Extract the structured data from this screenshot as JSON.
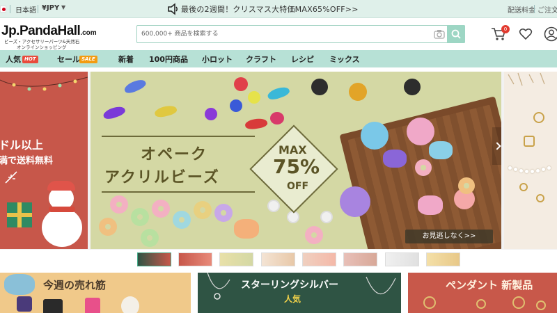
{
  "topbar": {
    "language": "日本語",
    "currency": "¥JPY",
    "announcement": "最後の2週間！クリスマス大特価MAX65%OFF>>",
    "shipping_fee": "配送料金",
    "order_guide": "ご注文"
  },
  "header": {
    "logo_main": "Jp.PandaHall",
    "logo_com": ".com",
    "logo_sub1": "ビーズ・アクセサリーパーツ&天然石",
    "logo_sub2": "オンラインショッピング",
    "search_placeholder": "600,000+ 商品を検索する",
    "cart_count": "0"
  },
  "nav": {
    "items": [
      {
        "label": "人気",
        "badge": "HOT"
      },
      {
        "label": "セール",
        "badge": "SALE"
      },
      {
        "label": "新着"
      },
      {
        "label": "100円商品"
      },
      {
        "label": "小ロット"
      },
      {
        "label": "クラフト"
      },
      {
        "label": "レシピ"
      },
      {
        "label": "ミックス"
      }
    ]
  },
  "hero": {
    "left_line1": "ドル以上",
    "left_line2": "満で送料無料",
    "title_line1": "オペーク",
    "title_line2": "アクリルビーズ",
    "badge_max": "MAX",
    "badge_percent": "75%",
    "badge_off": "OFF",
    "see_more": "お見逃しなく>>"
  },
  "cards": {
    "weekly_bestsellers": "今週の売れ筋",
    "sterling_silver": "スターリングシルバー",
    "sterling_silver_badge": "人気",
    "pendant_new": "ペンダント 新製品"
  },
  "colors": {
    "topbar_bg": "#dff0ea",
    "nav_bg": "#b7e1d6",
    "accent": "#9dd6c4",
    "hot_badge": "#e94b3c",
    "sale_badge": "#f39c12"
  }
}
